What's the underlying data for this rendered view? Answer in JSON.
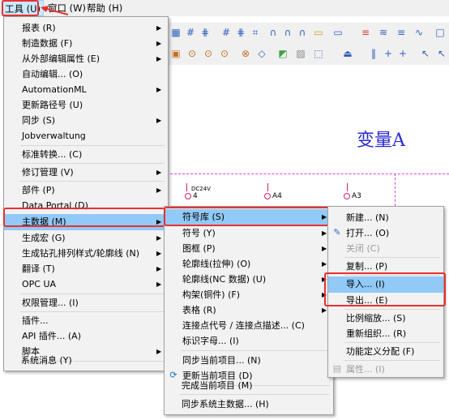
{
  "menubar": {
    "items": [
      {
        "label": "工具 (U)"
      },
      {
        "label": "窗口 (W)"
      },
      {
        "label": "帮助 (H)"
      }
    ]
  },
  "canvas": {
    "title": "变量A",
    "pins": [
      "4",
      "A4",
      "A3"
    ],
    "pin_small_label": "DC24V"
  },
  "tools_menu": {
    "items": [
      {
        "label": "报表 (R)",
        "submenu": true
      },
      {
        "label": "制造数据 (F)",
        "submenu": true
      },
      {
        "label": "从外部编辑属性 (E)",
        "submenu": true
      },
      {
        "label": "自动编辑... (O)",
        "submenu": false
      },
      {
        "label": "AutomationML",
        "submenu": true
      },
      {
        "label": "更新路径号 (U)",
        "submenu": false
      },
      {
        "label": "同步 (S)",
        "submenu": true
      },
      {
        "label": "Jobverwaltung",
        "submenu": false
      },
      {
        "label": "标准转换... (C)",
        "submenu": false
      },
      {
        "label": "修订管理 (V)",
        "submenu": true
      },
      {
        "label": "部件 (P)",
        "submenu": true
      },
      {
        "label": "Data Portal (D)",
        "submenu": false
      },
      {
        "label": "主数据 (M)",
        "submenu": true
      },
      {
        "label": "生成宏 (G)",
        "submenu": true
      },
      {
        "label": "生成钻孔排列样式/轮廓线 (N)",
        "submenu": true
      },
      {
        "label": "翻译 (T)",
        "submenu": true
      },
      {
        "label": "OPC UA",
        "submenu": true
      },
      {
        "label": "权限管理... (I)",
        "submenu": false
      },
      {
        "label": "插件...",
        "submenu": false
      },
      {
        "label": "API 插件... (A)",
        "submenu": false
      },
      {
        "label": "脚本",
        "submenu": true
      },
      {
        "label": "系统消息 (Y)",
        "submenu": false
      }
    ]
  },
  "masterdata_menu": {
    "items": [
      {
        "label": "符号库 (S)",
        "submenu": true
      },
      {
        "label": "符号 (Y)",
        "submenu": true
      },
      {
        "label": "图框 (P)",
        "submenu": true
      },
      {
        "label": "轮廓线(拉伸) (O)",
        "submenu": true
      },
      {
        "label": "轮廓线(NC 数据) (U)",
        "submenu": true
      },
      {
        "label": "构架(铜件) (F)",
        "submenu": true
      },
      {
        "label": "表格 (R)",
        "submenu": true
      },
      {
        "label": "连接点代号 / 连接点描述... (C)",
        "submenu": false
      },
      {
        "label": "标识字母... (I)",
        "submenu": false
      },
      {
        "label": "同步当前项目... (N)",
        "submenu": false
      },
      {
        "label": "更新当前项目 (D)",
        "submenu": false
      },
      {
        "label": "完成当前项目 (M)",
        "submenu": false
      },
      {
        "label": "同步系统主数据... (H)",
        "submenu": false
      }
    ]
  },
  "symbollib_menu": {
    "items": [
      {
        "label": "新建... (N)"
      },
      {
        "label": "打开... (O)"
      },
      {
        "label": "关闭 (C)"
      },
      {
        "label": "复制... (P)"
      },
      {
        "label": "导入... (I)"
      },
      {
        "label": "导出... (E)"
      },
      {
        "label": "比例缩放... (S)"
      },
      {
        "label": "重新组织... (R)"
      },
      {
        "label": "功能定义分配 (F)"
      },
      {
        "label": "属性... (I)"
      }
    ]
  },
  "colors": {
    "highlight": "#91c9f7",
    "annotation": "#e83030",
    "canvas_title": "#2a2ad0"
  }
}
